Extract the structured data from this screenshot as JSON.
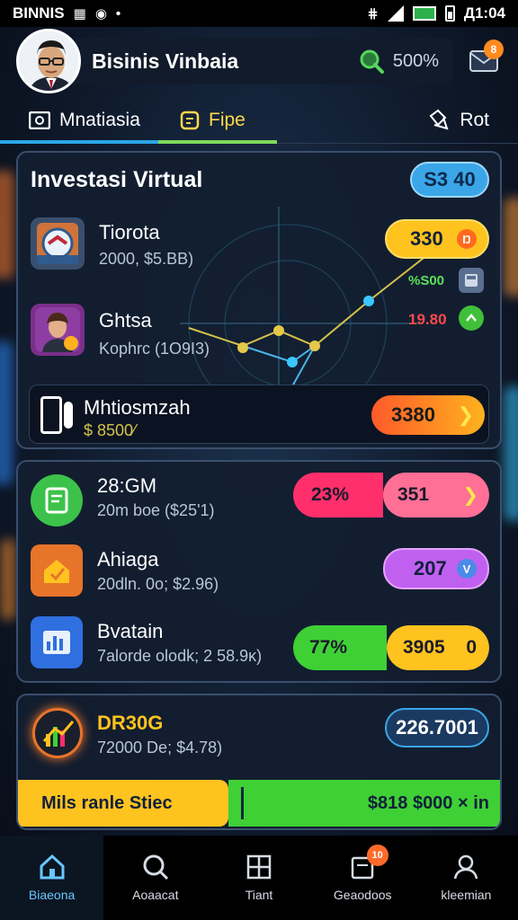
{
  "status_bar": {
    "left": "BINNIS",
    "time": "Д1:04"
  },
  "header": {
    "app_name": "Bisinis Vinbaia",
    "search_value": "500%",
    "notif_count": "8"
  },
  "tabs": [
    {
      "label": "Mnatiasia"
    },
    {
      "label": "Fipe"
    },
    {
      "label": "Rot"
    }
  ],
  "investment": {
    "title": "Investasi Virtual",
    "balance": "S3 40",
    "rows": [
      {
        "name": "Tiorota",
        "sub": "2000, $5.BB)",
        "value": "330",
        "value_icon": "Ŋ",
        "extra": "%S00"
      },
      {
        "name": "Ghtsa",
        "sub": "Kophrc (1O9I3)",
        "value": "19.80"
      }
    ],
    "featured": {
      "name": "Mhtiosmzah",
      "sub": "$ 8500⁄",
      "value": "3380"
    }
  },
  "assets": [
    {
      "name": "28:GM",
      "sub": "20m boe ($25'1)",
      "pct": "23%",
      "value": "351",
      "color_a": "#ff2f6c",
      "color_b": "#ff6f96"
    },
    {
      "name": "Ahiaga",
      "sub": "20dln. 0o; $2.96)",
      "value": "207",
      "color_b": "#c060f0"
    },
    {
      "name": "Bvatain",
      "sub": "7alorde olodk; 2 58.9ĸ)",
      "pct": "77%",
      "value": "3905",
      "value_icon": "0",
      "color_a": "#3fd035",
      "color_b": "#ffc31f"
    }
  ],
  "promo": {
    "name": "DR30G",
    "sub": "72000 De; $4.78)",
    "value": "226.7001",
    "bar_left": "Mils ranle Stiec",
    "bar_right": "$818 $000 × in"
  },
  "nav": [
    {
      "label": "Biaeona",
      "icon": "home-icon"
    },
    {
      "label": "Aoaacat",
      "icon": "search-icon"
    },
    {
      "label": "Tiant",
      "icon": "grid-icon"
    },
    {
      "label": "Geaodoos",
      "icon": "docs-icon",
      "badge": "10"
    },
    {
      "label": "kleemian",
      "icon": "user-icon"
    }
  ]
}
